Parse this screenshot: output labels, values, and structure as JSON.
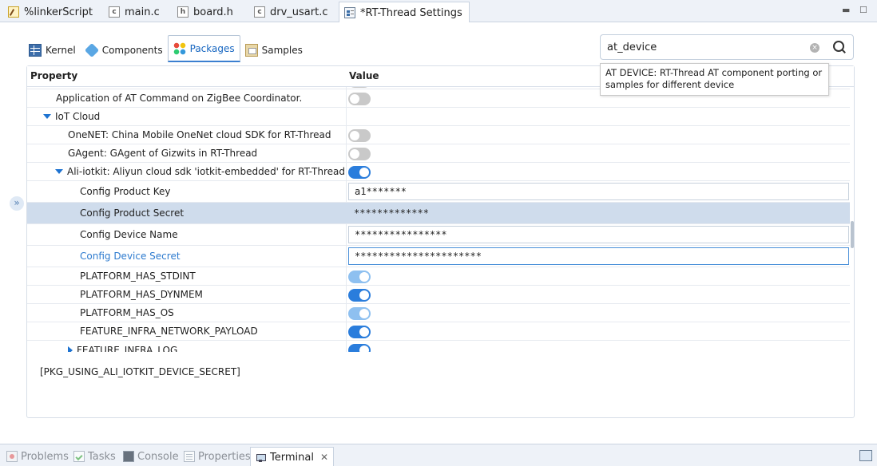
{
  "editor_tabs": [
    {
      "label": "%linkerScript",
      "icon": "linker-script-icon"
    },
    {
      "label": "main.c",
      "icon": "c-file-icon"
    },
    {
      "label": "board.h",
      "icon": "h-file-icon"
    },
    {
      "label": "drv_usart.c",
      "icon": "c-file-icon"
    },
    {
      "label": "*RT-Thread Settings",
      "icon": "settings-file-icon",
      "active": true,
      "close": "✕"
    }
  ],
  "window_controls": {
    "minimize": "▬",
    "maximize": "☐"
  },
  "settings_tabs": [
    {
      "label": "Kernel",
      "icon": "kernel-icon"
    },
    {
      "label": "Components",
      "icon": "components-icon"
    },
    {
      "label": "Packages",
      "icon": "packages-icon",
      "active": true
    },
    {
      "label": "Samples",
      "icon": "samples-icon"
    }
  ],
  "search": {
    "value": "at_device",
    "clear": "×"
  },
  "tooltip": "AT DEVICE: RT-Thread AT component porting or samples for different device",
  "table": {
    "header": {
      "property": "Property",
      "value": "Value"
    },
    "rows": [
      {
        "label": "Application of AT Command on ZigBee Coordinator.",
        "type": "toggle",
        "state": "off"
      },
      {
        "label": "IoT Cloud",
        "type": "group",
        "expanded": true
      },
      {
        "label": "OneNET: China Mobile OneNet cloud SDK for RT-Thread",
        "type": "toggle",
        "state": "off"
      },
      {
        "label": "GAgent: GAgent of Gizwits in RT-Thread",
        "type": "toggle",
        "state": "off"
      },
      {
        "label": "Ali-iotkit: Aliyun cloud sdk 'iotkit-embedded' for RT-Thread",
        "type": "toggle",
        "state": "on",
        "expanded": true
      },
      {
        "label": "Config Product Key",
        "type": "text",
        "value": "a1*******"
      },
      {
        "label": "Config Product Secret",
        "type": "text",
        "value": "*************",
        "selected": true
      },
      {
        "label": "Config Device Name",
        "type": "text",
        "value": "****************"
      },
      {
        "label": "Config Device Secret",
        "type": "text",
        "value": "**********************",
        "focused": true
      },
      {
        "label": "PLATFORM_HAS_STDINT",
        "type": "toggle",
        "state": "dim"
      },
      {
        "label": "PLATFORM_HAS_DYNMEM",
        "type": "toggle",
        "state": "on"
      },
      {
        "label": "PLATFORM_HAS_OS",
        "type": "toggle",
        "state": "dim"
      },
      {
        "label": "FEATURE_INFRA_NETWORK_PAYLOAD",
        "type": "toggle",
        "state": "on"
      },
      {
        "label": "FEATURE_INFRA_LOG",
        "type": "toggle",
        "state": "on",
        "collapsed": true
      }
    ]
  },
  "description": "[PKG_USING_ALI_IOTKIT_DEVICE_SECRET]",
  "expander": "»",
  "bottom_tabs": [
    {
      "label": "Problems",
      "icon": "problems-icon"
    },
    {
      "label": "Tasks",
      "icon": "tasks-icon"
    },
    {
      "label": "Console",
      "icon": "console-icon"
    },
    {
      "label": "Properties",
      "icon": "properties-icon"
    },
    {
      "label": "Terminal",
      "icon": "terminal-icon",
      "active": true,
      "close": "✕"
    }
  ],
  "colors": {
    "accent": "#2a7ddc",
    "selection": "#cfdcec",
    "link": "#2e7bcf"
  }
}
